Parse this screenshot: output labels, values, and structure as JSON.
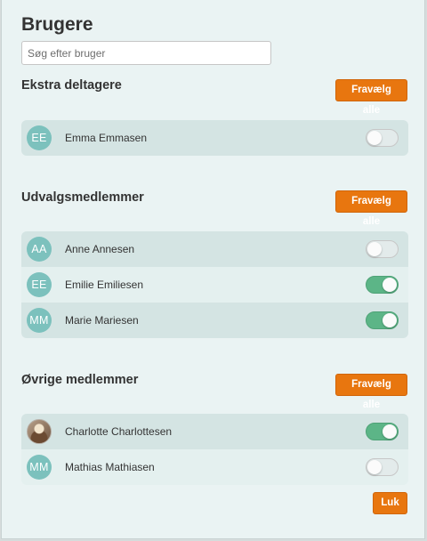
{
  "title": "Brugere",
  "search": {
    "placeholder": "Søg efter bruger",
    "value": ""
  },
  "colors": {
    "accent": "#e8760f",
    "toggle_on": "#5cb587",
    "avatar": "#7cc1bd"
  },
  "sections": [
    {
      "title": "Ekstra deltagere",
      "button": "Fravælg alle",
      "members": [
        {
          "initials": "EE",
          "name": "Emma Emmasen",
          "selected": false
        }
      ]
    },
    {
      "title": "Udvalgsmedlemmer",
      "button": "Fravælg alle",
      "members": [
        {
          "initials": "AA",
          "name": "Anne Annesen",
          "selected": false
        },
        {
          "initials": "EE",
          "name": "Emilie Emiliesen",
          "selected": true
        },
        {
          "initials": "MM",
          "name": "Marie Mariesen",
          "selected": true
        }
      ]
    },
    {
      "title": "Øvrige medlemmer",
      "button": "Fravælg alle",
      "members": [
        {
          "initials": "",
          "name": "Charlotte Charlottesen",
          "selected": true,
          "avatar": "photo"
        },
        {
          "initials": "MM",
          "name": "Mathias Mathiasen",
          "selected": false
        }
      ]
    }
  ],
  "close_button": "Luk"
}
